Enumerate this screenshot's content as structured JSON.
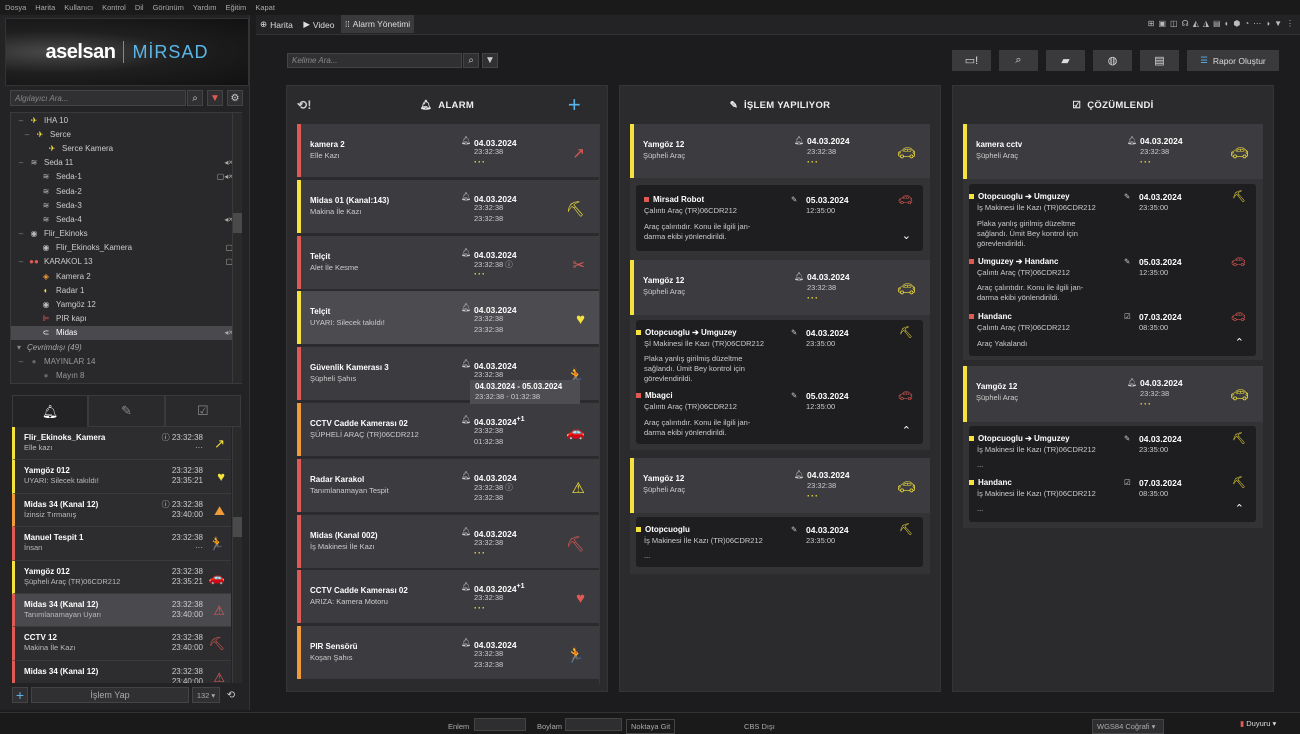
{
  "menu": [
    "Dosya",
    "Harita",
    "Kullanıcı",
    "Kontrol",
    "Dil",
    "Görünüm",
    "Yardım",
    "Eğitim",
    "Kapat"
  ],
  "logo": {
    "brand": "aselsan",
    "product": "MİRSAD"
  },
  "sensor_search": {
    "placeholder": "Algılayıcı Ara..."
  },
  "tree": [
    {
      "label": "IHA 10",
      "ex": "–",
      "icon": "drone-icon",
      "ind": 1,
      "col": "#f5e23c",
      "glyph": "✈",
      "right": ""
    },
    {
      "label": "Serce",
      "ex": "–",
      "icon": "drone-icon",
      "ind": 2,
      "col": "#f5e23c",
      "glyph": "✈",
      "right": ""
    },
    {
      "label": "Serce Kamera",
      "ex": "",
      "icon": "drone-icon",
      "ind": 4,
      "col": "#f5e23c",
      "glyph": "✈",
      "right": ""
    },
    {
      "label": "Seda 11",
      "ex": "–",
      "icon": "seismic-sensor-icon",
      "ind": 1,
      "col": "#bbb",
      "glyph": "≋",
      "right": "◂×"
    },
    {
      "label": "Seda-1",
      "ex": "",
      "icon": "seismic-sensor-icon",
      "ind": 3,
      "col": "#bbb",
      "glyph": "≋",
      "right": "▢◂×"
    },
    {
      "label": "Seda-2",
      "ex": "",
      "icon": "seismic-sensor-icon",
      "ind": 3,
      "col": "#bbb",
      "glyph": "≋",
      "right": ""
    },
    {
      "label": "Seda-3",
      "ex": "",
      "icon": "seismic-sensor-icon",
      "ind": 3,
      "col": "#bbb",
      "glyph": "≋",
      "right": ""
    },
    {
      "label": "Seda-4",
      "ex": "",
      "icon": "seismic-sensor-icon",
      "ind": 3,
      "col": "#bbb",
      "glyph": "≋",
      "right": "◂×"
    },
    {
      "label": "Flir_Ekinoks",
      "ex": "–",
      "icon": "camera-icon",
      "ind": 1,
      "col": "#bbb",
      "glyph": "◉",
      "right": ""
    },
    {
      "label": "Flir_Ekinoks_Kamera",
      "ex": "",
      "icon": "camera-icon",
      "ind": 3,
      "col": "#bbb",
      "glyph": "◉",
      "right": "▢"
    },
    {
      "label": "KARAKOL 13",
      "ex": "–",
      "icon": "outpost-icon",
      "ind": 1,
      "col": "#e05a55",
      "glyph": "●●",
      "right": "▢"
    },
    {
      "label": "Kamera 2",
      "ex": "",
      "icon": "camera-icon",
      "ind": 3,
      "col": "#f09a3a",
      "glyph": "◈",
      "right": ""
    },
    {
      "label": "Radar 1",
      "ex": "",
      "icon": "radar-icon",
      "ind": 3,
      "col": "#f5e23c",
      "glyph": "◐",
      "right": ""
    },
    {
      "label": "Yamgöz 12",
      "ex": "",
      "icon": "camera-icon",
      "ind": 3,
      "col": "#bbb",
      "glyph": "◉",
      "right": ""
    },
    {
      "label": "PIR kapı",
      "ex": "",
      "icon": "pir-icon",
      "ind": 3,
      "col": "#e05a55",
      "glyph": "⊫",
      "right": ""
    },
    {
      "label": "Midas",
      "ex": "",
      "icon": "midas-icon",
      "ind": 3,
      "col": "#fff",
      "glyph": "⊂",
      "right": "◂×",
      "sel": true
    }
  ],
  "tree_offline": "Çevrimdışı (49)",
  "tree_mayinlar": "MAYINLAR 14",
  "tree_mayin": "Mayın 8",
  "left_list": [
    {
      "t": "Flir_Ekinoks_Kamera",
      "s": "Elle kazı",
      "tm": [
        "ⓘ 23:32:38",
        "···"
      ],
      "col": "y",
      "ico": "↗",
      "icol": "#f5e23c",
      "name": "arrow-icon"
    },
    {
      "t": "Yamgöz 012",
      "s": "UYARI: Silecek takıldı!",
      "tm": [
        "23:32:38",
        "23:35:21"
      ],
      "col": "y",
      "ico": "♥",
      "icol": "#f5e23c",
      "name": "heart-icon"
    },
    {
      "t": "Midas 34 (Kanal 12)",
      "s": "İzinsiz Tırmanış",
      "tm": [
        "ⓘ 23:32:38",
        "23:40:00"
      ],
      "col": "org",
      "ico": "⛰",
      "icol": "#f09a3a",
      "name": "climb-icon"
    },
    {
      "t": "Manuel Tespit 1",
      "s": "İnsan",
      "tm": [
        "23:32:38",
        "···"
      ],
      "col": "red",
      "ico": "🏃",
      "icol": "#e05a55",
      "name": "runner-icon"
    },
    {
      "t": "Yamgöz 012",
      "s": "Şüpheli Araç (TR)06CDR212",
      "tm": [
        "23:32:38",
        "23:35:21"
      ],
      "col": "y",
      "ico": "🚗",
      "icol": "#f5e23c",
      "name": "car-icon"
    },
    {
      "t": "Midas 34 (Kanal 12)",
      "s": "Tanımlanamayan Uyarı",
      "tm": [
        "23:32:38",
        "23:40:00"
      ],
      "col": "red",
      "ico": "⚠",
      "icol": "#e05a55",
      "name": "warning-icon",
      "sel": true
    },
    {
      "t": "CCTV 12",
      "s": "Makina İle Kazı",
      "tm": [
        "23:32:38",
        "23:40:00"
      ],
      "col": "red",
      "ico": "⛏",
      "icol": "#e05a55",
      "name": "excavator-icon"
    },
    {
      "t": "Midas 34 (Kanal 12)",
      "s": "",
      "tm": [
        "23:32:38",
        "23:40:00"
      ],
      "col": "red",
      "ico": "⚠",
      "icol": "#e05a55",
      "name": "warning-icon"
    }
  ],
  "bottom": {
    "action": "İşlem Yap",
    "count": "132 ▾"
  },
  "top_tabs": [
    "Harita",
    "Video",
    "Alarm Yönetimi"
  ],
  "keyword_search": {
    "placeholder": "Kelime Ara..."
  },
  "rapor": "Rapor Oluştur",
  "col_alarm": "ALARM",
  "col_islem": "İŞLEM YAPILIYOR",
  "col_cozum": "ÇÖZÜMLENDİ",
  "alarm_cards": [
    {
      "t": "kamera 2",
      "s": "Elle Kazı",
      "d": "04.03.2024",
      "h1": "23:32:38",
      "h2": "···",
      "col": "red",
      "ico": "↗",
      "icol": "#e05a55",
      "name": "arrow-icon"
    },
    {
      "t": "Midas 01 (Kanal:143)",
      "s": "Makina İle Kazı",
      "d": "04.03.2024",
      "h1": "23:32:38",
      "h2": "23:32:38",
      "col": "y",
      "ico": "⛏",
      "icol": "#f5e23c",
      "name": "drill-icon"
    },
    {
      "t": "Telçit",
      "s": "Alet İle Kesme",
      "d": "04.03.2024",
      "h1": "23:32:38 ⓘ",
      "h2": "···",
      "col": "red",
      "ico": "✂",
      "icol": "#e05a55",
      "name": "scissors-icon"
    },
    {
      "t": "Telçit",
      "s": "UYARI: Silecek takıldı!",
      "d": "04.03.2024",
      "h1": "23:32:38",
      "h2": "23:32:38",
      "col": "y",
      "ico": "♥",
      "icol": "#f5e23c",
      "name": "heart-icon",
      "sel": true
    },
    {
      "t": "Güvenlik Kamerası 3",
      "s": "Şüpheli Şahıs",
      "d": "04.03.2024",
      "h1": "23:32:38",
      "h2": "",
      "col": "red",
      "ico": "🏃",
      "icol": "#e05a55",
      "name": "runner-icon"
    },
    {
      "t": "CCTV Cadde Kamerası 02",
      "s": "ŞÜPHELİ ARAÇ (TR)06CDR212",
      "d": "04.03.2024",
      "sup": "+1",
      "h1": "23:32:38",
      "h2": "01:32:38",
      "col": "org",
      "ico": "🚗",
      "icol": "#f09a3a",
      "name": "car-icon"
    },
    {
      "t": "Radar Karakol",
      "s": "Tanımlanamayan Tespit",
      "d": "04.03.2024",
      "h1": "23:32:38 ⓘ",
      "h2": "23:32:38",
      "col": "red",
      "ico": "⚠",
      "icol": "#f5e23c",
      "name": "warning-icon"
    },
    {
      "t": "Midas (Kanal 002)",
      "s": "İş Makinesi İle Kazı",
      "d": "04.03.2024",
      "h1": "23:32:38",
      "h2": "···",
      "col": "red",
      "ico": "⛏",
      "icol": "#e05a55",
      "name": "excavator-icon"
    },
    {
      "t": "CCTV Cadde Kamerası 02",
      "s": "ARIZA: Kamera Motoru",
      "d": "04.03.2024",
      "sup": "+1",
      "h1": "23:32:38",
      "h2": "···",
      "col": "red",
      "ico": "♥",
      "icol": "#e05a55",
      "name": "heart-icon"
    },
    {
      "t": "PIR Sensörü",
      "s": "Koşan Şahıs",
      "d": "04.03.2024",
      "h1": "23:32:38",
      "h2": "23:32:38",
      "col": "org",
      "ico": "🏃",
      "icol": "#f09a3a",
      "name": "runner-icon"
    }
  ],
  "tooltip": {
    "range": "04.03.2024 - 05.03.2024",
    "times": "23:32:38   -   01:32:38"
  },
  "islem": {
    "c1": {
      "t": "Yamgöz 12",
      "s": "Şüpheli Araç",
      "d": "04.03.2024",
      "h1": "23:32:38",
      "h2": "···"
    },
    "s1": {
      "name": "Mirsad Robot",
      "desc": "Çalıntı Araç (TR)06CDR212",
      "d": "05.03.2024",
      "h": "12:35:00",
      "note": "Araç çalıntıdır. Konu ile ilgili jan-",
      "note2": "darma ekibi yönlendirildi."
    },
    "c2": {
      "t": "Yamgöz 12",
      "s": "Şüpheli Araç",
      "d": "04.03.2024",
      "h1": "23:32:38",
      "h2": "···"
    },
    "s2": {
      "name": "Otopcuoglu ➔ Umguzey",
      "desc": "Şİ Makinesi İle Kazı (TR)06CDR212",
      "d": "04.03.2024",
      "h": "23:35:00",
      "note": "Plaka yanlış girilmiş düzeltme",
      "note2": "sağlandı. Ümit Bey kontrol için",
      "note3": "görevlendirildi.",
      "name2": "Mbagci",
      "desc2": "Çalıntı Araç (TR)06CDR212",
      "d2": "05.03.2024",
      "h2": "12:35:00",
      "n4": "Araç çalıntıdır. Konu ile ilgili jan-",
      "n5": "darma ekibi yönlendirildi."
    },
    "c3": {
      "t": "Yamgöz 12",
      "s": "Şüpheli Araç",
      "d": "04.03.2024",
      "h1": "23:32:38",
      "h2": "···"
    },
    "s3": {
      "name": "Otopcuoglu",
      "desc": "İş Makinesi İle Kazı (TR)06CDR212",
      "d": "04.03.2024",
      "h": "23:35:00",
      "note": "..."
    }
  },
  "cozum": {
    "c1": {
      "t": "kamera cctv",
      "s": "Şüpheli Araç",
      "d": "04.03.2024",
      "h1": "23:32:38",
      "h2": "···"
    },
    "s1": {
      "name": "Otopcuoglu ➔ Umguzey",
      "desc": "İş Makinesi İle Kazı (TR)06CDR212",
      "d": "04.03.2024",
      "h": "23:35:00",
      "n1": "Plaka yanlış girilmiş düzeltme",
      "n2": "sağlandı. Ümit Bey kontrol için",
      "n3": "görevlendirildi.",
      "name2": "Umguzey ➔ Handanc",
      "desc2": "Çalıntı Araç (TR)06CDR212",
      "d2": "05.03.2024",
      "h2": "12:35:00",
      "n4": "Araç çalıntıdır. Konu ile ilgili jan-",
      "n5": "darma ekibi yönlendirildi.",
      "name3": "Handanc",
      "desc3": "Çalıntı Araç (TR)06CDR212",
      "d3": "07.03.2024",
      "h3": "08:35:00",
      "n6": "Araç Yakalandı"
    },
    "c2": {
      "t": "Yamgöz 12",
      "s": "Şüpheli Araç",
      "d": "04.03.2024",
      "h1": "23:32:38",
      "h2": "···"
    },
    "s2": {
      "name": "Otopcuoglu ➔ Umguzey",
      "desc": "İş Makinesi İle Kazı (TR)06CDR212",
      "d": "04.03.2024",
      "h": "23:35:00",
      "n1": "...",
      "name2": "Handanc",
      "desc2": "İş Makinesi İle Kazı (TR)06CDR212",
      "d2": "07.03.2024",
      "h2": "08:35:00",
      "n2": "..."
    }
  },
  "status": {
    "enlem": "Enlem",
    "boylam": "Boylam",
    "noktaya": "Noktaya Git",
    "cbs": "CBS Dışı",
    "wgs": "WGS84 Coğrafi",
    "duyuru": "Duyuru"
  }
}
